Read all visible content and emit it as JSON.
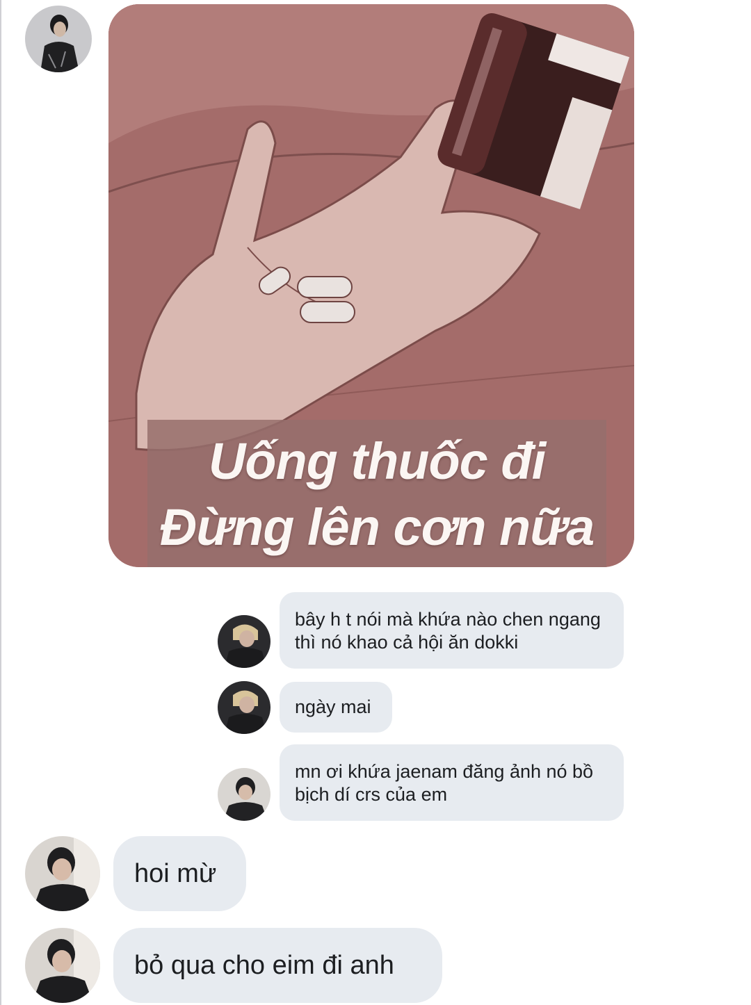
{
  "conversation": {
    "meme": {
      "caption_line1": "Uống thuốc đi",
      "caption_line2": "Đừng lên cơn nữa"
    },
    "replies": [
      {
        "text": "bây h t nói mà khứa nào chen ngang thì nó khao cả hội ăn dokki"
      },
      {
        "text": "ngày mai"
      },
      {
        "text": "mn ơi khứa jaenam đăng ảnh nó bồ bịch dí crs của em"
      }
    ],
    "messages": [
      {
        "text": "hoi mừ"
      },
      {
        "text": "bỏ qua cho eim đi anh"
      }
    ]
  },
  "colors": {
    "bubble": "#e7ebf0",
    "text": "#1c1e21",
    "meme_bg": "#a46c6a",
    "caption_bg": "#966e6c"
  }
}
